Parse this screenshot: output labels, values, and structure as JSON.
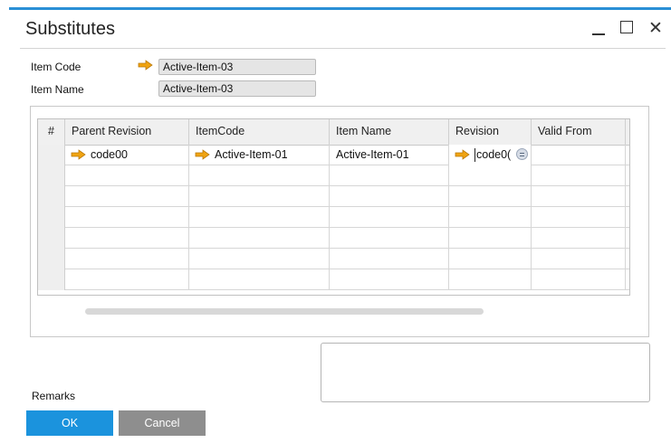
{
  "window": {
    "title": "Substitutes",
    "close_glyph": "✕"
  },
  "header_fields": {
    "item_code_label": "Item Code",
    "item_code_value": "Active-Item-03",
    "item_name_label": "Item Name",
    "item_name_value": "Active-Item-03"
  },
  "grid": {
    "columns": [
      "#",
      "Parent Revision",
      "ItemCode",
      "Item Name",
      "Revision",
      "Valid From"
    ],
    "rows": [
      {
        "parent_revision": "code00",
        "item_code": "Active-Item-01",
        "item_name": "Active-Item-01",
        "revision": "code0("
      }
    ]
  },
  "remarks": {
    "label": "Remarks",
    "value": ""
  },
  "buttons": {
    "ok_label": "OK",
    "cancel_label": "Cancel"
  },
  "icons": {
    "link_arrow": "link-arrow-icon",
    "choose_from_list": "choose-from-list-icon"
  },
  "colors": {
    "accent_blue": "#1b93dd",
    "title_border": "#2a8fd6",
    "link_arrow_orange": "#f0a412",
    "cancel_gray": "#8e8e8e",
    "readonly_field": "#e5e5e5"
  }
}
